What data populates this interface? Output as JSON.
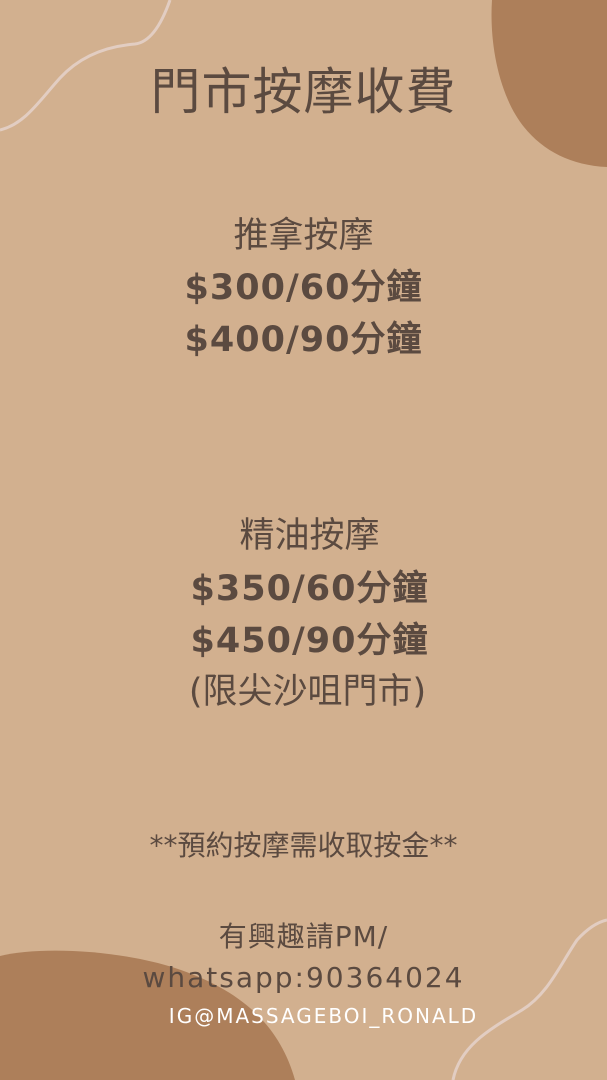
{
  "colors": {
    "background": "#d2b08f",
    "accent_blob": "#ad7f5a",
    "text": "#5b4a40",
    "ig_text": "#ffffff",
    "curve": "#e2cdc2"
  },
  "poster": {
    "title": "門市按摩收費",
    "tuina": {
      "name": "推拿按摩",
      "price_1": "$300/60分鐘",
      "price_2": "$400/90分鐘"
    },
    "oil": {
      "name": "精油按摩",
      "price_1": "$350/60分鐘",
      "price_2": "$450/90分鐘",
      "note": "(限尖沙咀門市)"
    },
    "deposit_note": "**預約按摩需收取按金**",
    "contact_line_1": "有興趣請PM/",
    "contact_line_2": "whatsapp:90364024",
    "instagram": "IG@MASSAGEBOI_RONALD"
  }
}
